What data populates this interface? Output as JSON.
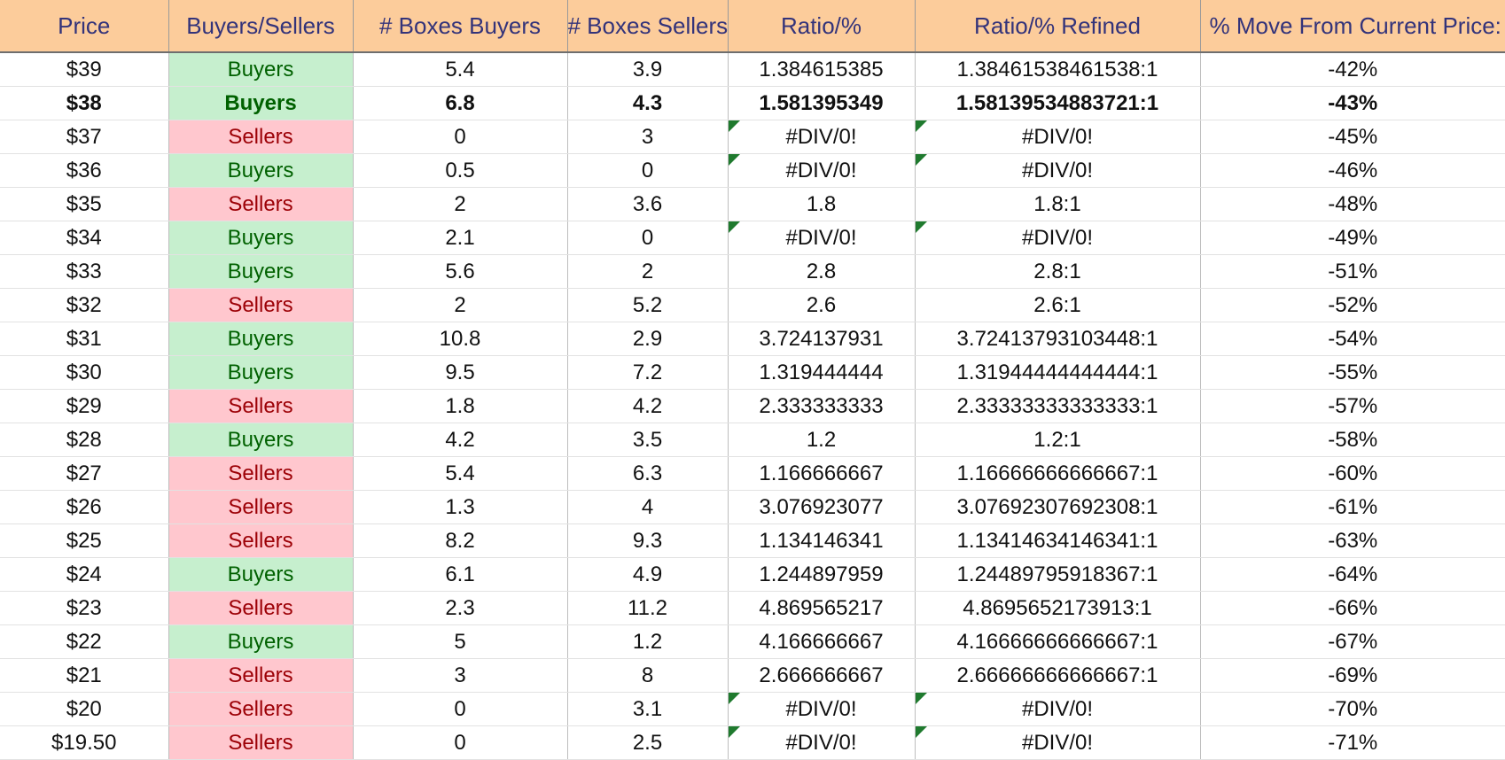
{
  "headers": [
    "Price",
    "Buyers/Sellers",
    "# Boxes Buyers",
    "# Boxes Sellers",
    "Ratio/%",
    "Ratio/% Refined",
    "% Move From Current Price:"
  ],
  "colors": {
    "header_bg": "#fccc9b",
    "header_text": "#33337a",
    "buyers_bg": "#c6efce",
    "buyers_text": "#006100",
    "sellers_bg": "#ffc7ce",
    "sellers_text": "#9c0006",
    "error_flag": "#1f7a2e"
  },
  "rows": [
    {
      "price": "$39",
      "side": "Buyers",
      "buyers": "5.4",
      "sellers": "3.9",
      "ratio": "1.384615385",
      "refined": "1.38461538461538:1",
      "move": "-42%",
      "bold": false,
      "err": false
    },
    {
      "price": "$38",
      "side": "Buyers",
      "buyers": "6.8",
      "sellers": "4.3",
      "ratio": "1.581395349",
      "refined": "1.58139534883721:1",
      "move": "-43%",
      "bold": true,
      "err": false
    },
    {
      "price": "$37",
      "side": "Sellers",
      "buyers": "0",
      "sellers": "3",
      "ratio": "#DIV/0!",
      "refined": "#DIV/0!",
      "move": "-45%",
      "bold": false,
      "err": true
    },
    {
      "price": "$36",
      "side": "Buyers",
      "buyers": "0.5",
      "sellers": "0",
      "ratio": "#DIV/0!",
      "refined": "#DIV/0!",
      "move": "-46%",
      "bold": false,
      "err": true
    },
    {
      "price": "$35",
      "side": "Sellers",
      "buyers": "2",
      "sellers": "3.6",
      "ratio": "1.8",
      "refined": "1.8:1",
      "move": "-48%",
      "bold": false,
      "err": false
    },
    {
      "price": "$34",
      "side": "Buyers",
      "buyers": "2.1",
      "sellers": "0",
      "ratio": "#DIV/0!",
      "refined": "#DIV/0!",
      "move": "-49%",
      "bold": false,
      "err": true
    },
    {
      "price": "$33",
      "side": "Buyers",
      "buyers": "5.6",
      "sellers": "2",
      "ratio": "2.8",
      "refined": "2.8:1",
      "move": "-51%",
      "bold": false,
      "err": false
    },
    {
      "price": "$32",
      "side": "Sellers",
      "buyers": "2",
      "sellers": "5.2",
      "ratio": "2.6",
      "refined": "2.6:1",
      "move": "-52%",
      "bold": false,
      "err": false
    },
    {
      "price": "$31",
      "side": "Buyers",
      "buyers": "10.8",
      "sellers": "2.9",
      "ratio": "3.724137931",
      "refined": "3.72413793103448:1",
      "move": "-54%",
      "bold": false,
      "err": false
    },
    {
      "price": "$30",
      "side": "Buyers",
      "buyers": "9.5",
      "sellers": "7.2",
      "ratio": "1.319444444",
      "refined": "1.31944444444444:1",
      "move": "-55%",
      "bold": false,
      "err": false
    },
    {
      "price": "$29",
      "side": "Sellers",
      "buyers": "1.8",
      "sellers": "4.2",
      "ratio": "2.333333333",
      "refined": "2.33333333333333:1",
      "move": "-57%",
      "bold": false,
      "err": false
    },
    {
      "price": "$28",
      "side": "Buyers",
      "buyers": "4.2",
      "sellers": "3.5",
      "ratio": "1.2",
      "refined": "1.2:1",
      "move": "-58%",
      "bold": false,
      "err": false
    },
    {
      "price": "$27",
      "side": "Sellers",
      "buyers": "5.4",
      "sellers": "6.3",
      "ratio": "1.166666667",
      "refined": "1.16666666666667:1",
      "move": "-60%",
      "bold": false,
      "err": false
    },
    {
      "price": "$26",
      "side": "Sellers",
      "buyers": "1.3",
      "sellers": "4",
      "ratio": "3.076923077",
      "refined": "3.07692307692308:1",
      "move": "-61%",
      "bold": false,
      "err": false
    },
    {
      "price": "$25",
      "side": "Sellers",
      "buyers": "8.2",
      "sellers": "9.3",
      "ratio": "1.134146341",
      "refined": "1.13414634146341:1",
      "move": "-63%",
      "bold": false,
      "err": false
    },
    {
      "price": "$24",
      "side": "Buyers",
      "buyers": "6.1",
      "sellers": "4.9",
      "ratio": "1.244897959",
      "refined": "1.24489795918367:1",
      "move": "-64%",
      "bold": false,
      "err": false
    },
    {
      "price": "$23",
      "side": "Sellers",
      "buyers": "2.3",
      "sellers": "11.2",
      "ratio": "4.869565217",
      "refined": "4.8695652173913:1",
      "move": "-66%",
      "bold": false,
      "err": false
    },
    {
      "price": "$22",
      "side": "Buyers",
      "buyers": "5",
      "sellers": "1.2",
      "ratio": "4.166666667",
      "refined": "4.16666666666667:1",
      "move": "-67%",
      "bold": false,
      "err": false
    },
    {
      "price": "$21",
      "side": "Sellers",
      "buyers": "3",
      "sellers": "8",
      "ratio": "2.666666667",
      "refined": "2.66666666666667:1",
      "move": "-69%",
      "bold": false,
      "err": false
    },
    {
      "price": "$20",
      "side": "Sellers",
      "buyers": "0",
      "sellers": "3.1",
      "ratio": "#DIV/0!",
      "refined": "#DIV/0!",
      "move": "-70%",
      "bold": false,
      "err": true
    },
    {
      "price": "$19.50",
      "side": "Sellers",
      "buyers": "0",
      "sellers": "2.5",
      "ratio": "#DIV/0!",
      "refined": "#DIV/0!",
      "move": "-71%",
      "bold": false,
      "err": true
    }
  ]
}
